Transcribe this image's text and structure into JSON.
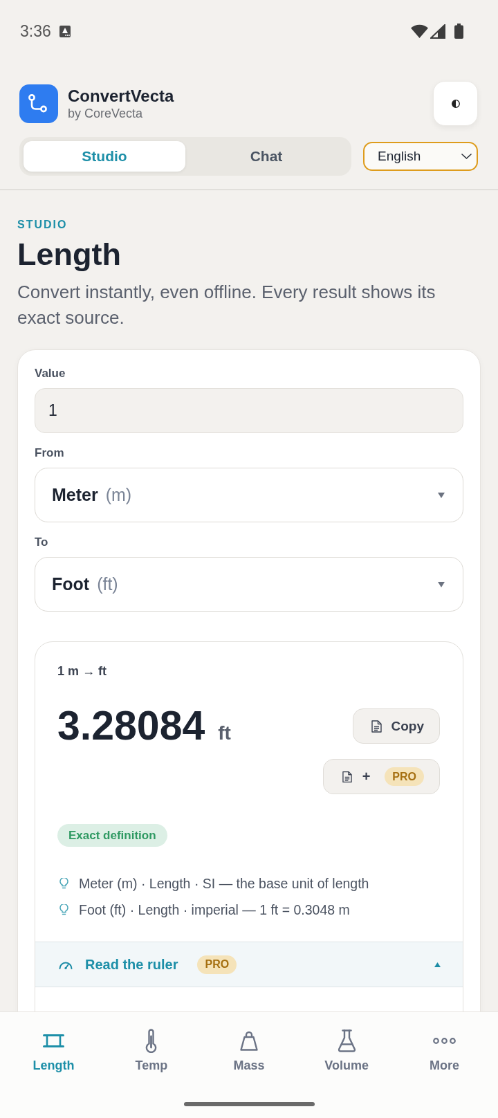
{
  "status_bar": {
    "time": "3:36"
  },
  "header": {
    "app_name": "ConvertVecta",
    "byline": "by CoreVecta"
  },
  "mode_tabs": [
    {
      "label": "Studio",
      "selected": true
    },
    {
      "label": "Chat",
      "selected": false
    }
  ],
  "language_select": {
    "value": "English"
  },
  "page": {
    "eyebrow": "STUDIO",
    "title": "Length",
    "description": "Convert instantly, even offline. Every result shows its exact source."
  },
  "converter": {
    "value_label": "Value",
    "value": "1",
    "from_label": "From",
    "from_unit": {
      "name": "Meter",
      "symbol": "(m)"
    },
    "to_label": "To",
    "to_unit": {
      "name": "Foot",
      "symbol": "(ft)"
    }
  },
  "result": {
    "expression": "1 m → ft",
    "value": "3.28084",
    "unit": "ft",
    "copy_label": "Copy",
    "add_label": "+",
    "add_badge": "PRO",
    "accuracy": "Exact definition",
    "sources": [
      "Meter (m) · Length · SI — the base unit of length",
      "Foot (ft) · Length · imperial — 1 ft = 0.3048 m"
    ]
  },
  "ruler_section": {
    "title": "Read the ruler",
    "badge": "PRO",
    "expanded": true
  },
  "bottom_nav": [
    {
      "kind": "length",
      "label": "Length",
      "selected": true
    },
    {
      "kind": "temperature",
      "label": "Temp",
      "selected": false
    },
    {
      "kind": "mass",
      "label": "Mass",
      "selected": false
    },
    {
      "kind": "volume",
      "label": "Volume",
      "selected": false
    },
    {
      "kind": "more",
      "label": "More",
      "selected": false
    }
  ]
}
